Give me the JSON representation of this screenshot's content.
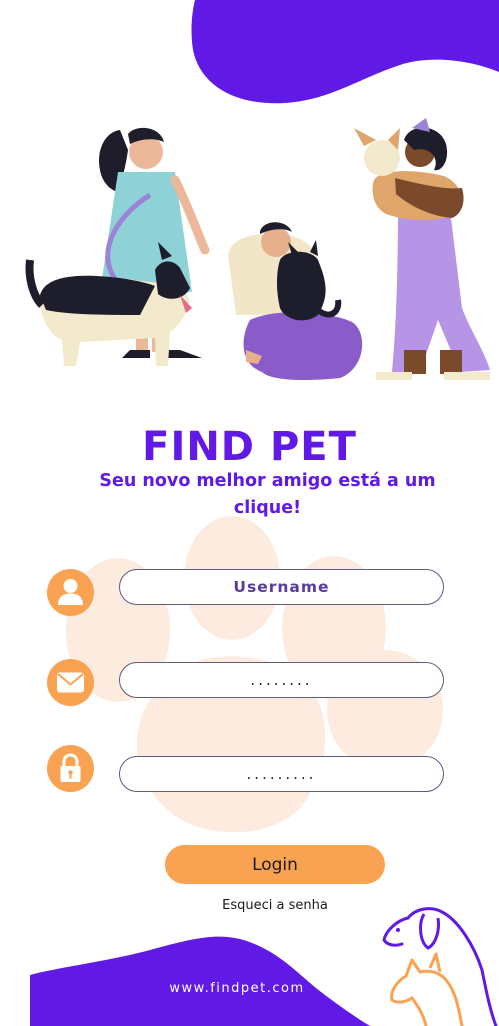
{
  "colors": {
    "brand_purple": "#6119e6",
    "accent_orange": "#f9a252",
    "paw_beige": "#fdebdf",
    "background": "#ffffff"
  },
  "brand": {
    "title": "FIND PET",
    "tagline": "Seu novo melhor amigo está a um clique!"
  },
  "illustration": {
    "description_icon": "people-with-pets-illustration"
  },
  "form": {
    "username": {
      "icon": "user-icon",
      "placeholder": "Username"
    },
    "email": {
      "icon": "mail-icon",
      "value_masked": "........"
    },
    "password": {
      "icon": "lock-icon",
      "value_masked": "........."
    },
    "login_label": "Login",
    "forgot_label": "Esqueci a senha"
  },
  "footer": {
    "website": "www.findpet.com",
    "corner_icon": "dog-and-cat-outline-icon"
  }
}
